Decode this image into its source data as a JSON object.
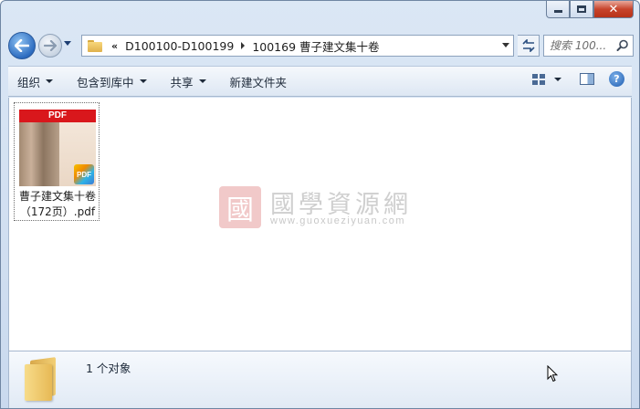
{
  "address": {
    "overflow_glyph": "«",
    "crumbs": [
      "D100100-D100199",
      "100169 曹子建文集十卷"
    ]
  },
  "search": {
    "placeholder": "搜索 100..."
  },
  "toolbar": {
    "organize": "组织",
    "include_in_library": "包含到库中",
    "share": "共享",
    "new_folder": "新建文件夹"
  },
  "file": {
    "name_line1": "曹子建文集十卷",
    "name_line2": "（172页）.pdf",
    "thumb_band": "PDF",
    "badge": "PDF"
  },
  "watermark": {
    "seal": "國",
    "title": "國學資源網",
    "url": "www.guoxueziyuan.com"
  },
  "status": {
    "count_text": "1 个对象"
  },
  "colors": {
    "accent": "#2d6cc0",
    "pdf_red": "#d9171c",
    "close_red": "#c7442c"
  }
}
